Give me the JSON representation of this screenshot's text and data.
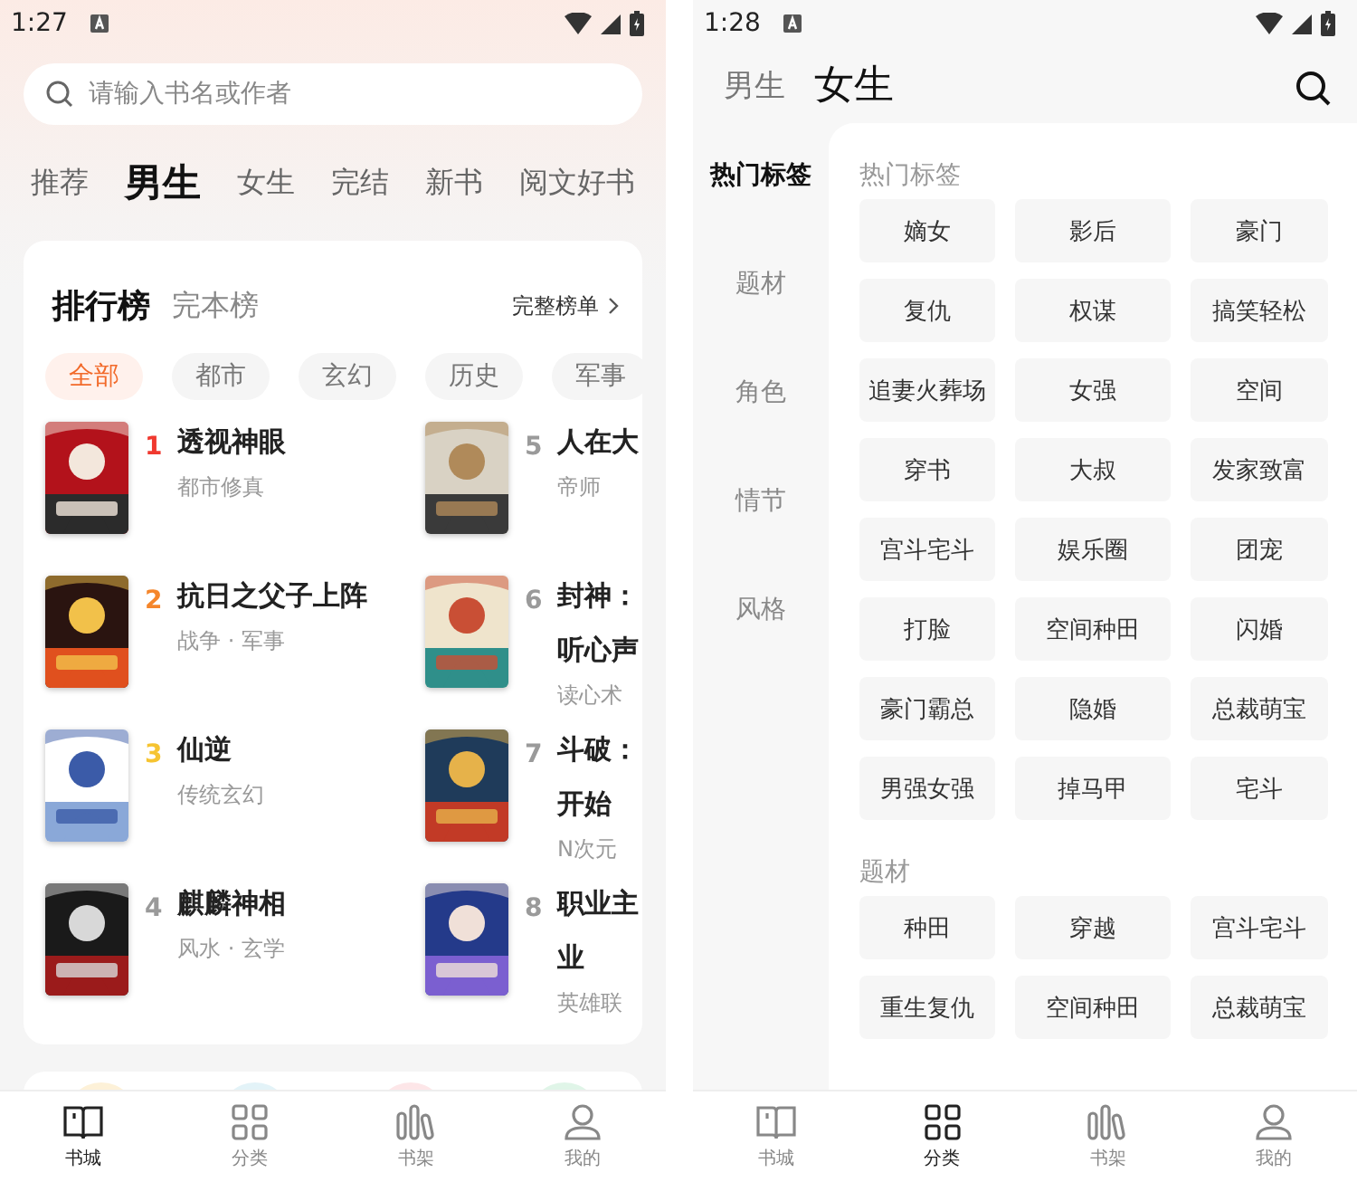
{
  "home_screen": {
    "status_bar": {
      "time": "1:27"
    },
    "search": {
      "placeholder": "请输入书名或作者"
    },
    "channel_tabs": [
      {
        "label": "推荐",
        "selected": false
      },
      {
        "label": "男生",
        "selected": true
      },
      {
        "label": "女生",
        "selected": false
      },
      {
        "label": "完结",
        "selected": false
      },
      {
        "label": "新书",
        "selected": false
      },
      {
        "label": "阅文好书",
        "selected": false
      }
    ],
    "ranking_card": {
      "tabs": [
        {
          "label": "排行榜",
          "selected": true
        },
        {
          "label": "完本榜",
          "selected": false
        }
      ],
      "more_link": "完整榜单",
      "filters": [
        {
          "label": "全部",
          "selected": true
        },
        {
          "label": "都市",
          "selected": false
        },
        {
          "label": "玄幻",
          "selected": false
        },
        {
          "label": "历史",
          "selected": false
        },
        {
          "label": "军事",
          "selected": false
        }
      ],
      "books": [
        {
          "rank": "1",
          "color": "#f0392f",
          "title_lines": [
            "透视神眼"
          ],
          "genre": "都市修真"
        },
        {
          "rank": "5",
          "color": "#9a9a9a",
          "title_lines": [
            "人在大"
          ],
          "genre": "帝师"
        },
        {
          "rank": "2",
          "color": "#f5862b",
          "title_lines": [
            "抗日之父子上阵"
          ],
          "genre": "战争 · 军事"
        },
        {
          "rank": "6",
          "color": "#9a9a9a",
          "title_lines": [
            "封神：",
            "听心声"
          ],
          "genre": "读心术"
        },
        {
          "rank": "3",
          "color": "#f6c431",
          "title_lines": [
            "仙逆"
          ],
          "genre": "传统玄幻"
        },
        {
          "rank": "7",
          "color": "#9a9a9a",
          "title_lines": [
            "斗破：",
            "开始"
          ],
          "genre": "N次元"
        },
        {
          "rank": "4",
          "color": "#9a9a9a",
          "title_lines": [
            "麒麟神相"
          ],
          "genre": "风水 · 玄学"
        },
        {
          "rank": "8",
          "color": "#9a9a9a",
          "title_lines": [
            "职业主",
            "业"
          ],
          "genre": "英雄联"
        }
      ]
    },
    "bottom_nav": [
      {
        "label": "书城",
        "selected": true
      },
      {
        "label": "分类",
        "selected": false
      },
      {
        "label": "书架",
        "selected": false
      },
      {
        "label": "我的",
        "selected": false
      }
    ]
  },
  "category_screen": {
    "status_bar": {
      "time": "1:28"
    },
    "gender_tabs": [
      {
        "label": "男生",
        "selected": false
      },
      {
        "label": "女生",
        "selected": true
      }
    ],
    "sidebar": [
      {
        "label": "热门标签",
        "selected": true
      },
      {
        "label": "题材",
        "selected": false
      },
      {
        "label": "角色",
        "selected": false
      },
      {
        "label": "情节",
        "selected": false
      },
      {
        "label": "风格",
        "selected": false
      }
    ],
    "sections": [
      {
        "title": "热门标签",
        "tags": [
          "嫡女",
          "影后",
          "豪门",
          "复仇",
          "权谋",
          "搞笑轻松",
          "追妻火葬场",
          "女强",
          "空间",
          "穿书",
          "大叔",
          "发家致富",
          "宫斗宅斗",
          "娱乐圈",
          "团宠",
          "打脸",
          "空间种田",
          "闪婚",
          "豪门霸总",
          "隐婚",
          "总裁萌宝",
          "男强女强",
          "掉马甲",
          "宅斗"
        ]
      },
      {
        "title": "题材",
        "tags": [
          "种田",
          "穿越",
          "宫斗宅斗",
          "重生复仇",
          "空间种田",
          "总裁萌宝"
        ]
      }
    ],
    "bottom_nav": [
      {
        "label": "书城",
        "selected": false
      },
      {
        "label": "分类",
        "selected": true
      },
      {
        "label": "书架",
        "selected": false
      },
      {
        "label": "我的",
        "selected": false
      }
    ]
  }
}
